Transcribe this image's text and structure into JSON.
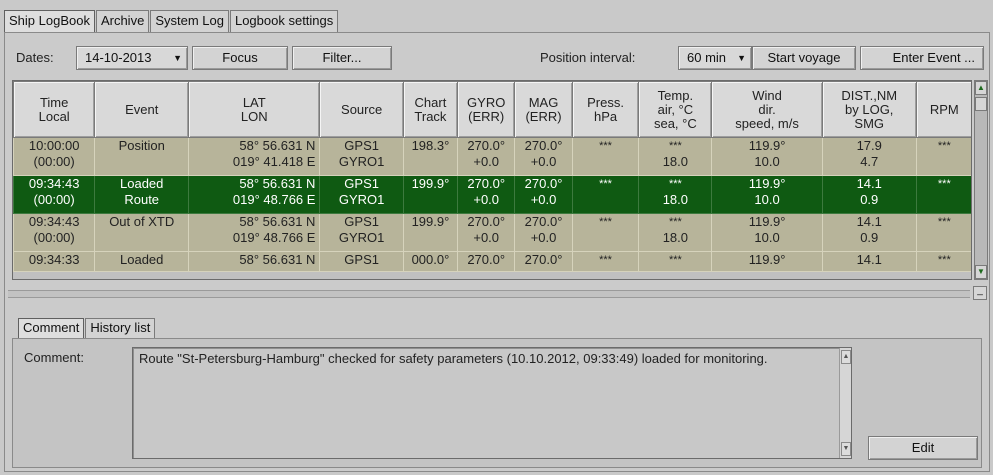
{
  "tabs": [
    "Ship LogBook",
    "Archive",
    "System Log",
    "Logbook settings"
  ],
  "toolbar": {
    "dates_label": "Dates:",
    "date_value": "14-10-2013",
    "focus": "Focus",
    "filter": "Filter...",
    "position_interval_label": "Position interval:",
    "interval_value": "60 min",
    "start_voyage": "Start voyage",
    "enter_event": "Enter Event ..."
  },
  "columns": [
    [
      "Time",
      "Local"
    ],
    [
      "Event"
    ],
    [
      "LAT",
      "LON"
    ],
    [
      "Source"
    ],
    [
      "Chart",
      "Track"
    ],
    [
      "GYRO",
      "(ERR)"
    ],
    [
      "MAG",
      "(ERR)"
    ],
    [
      "Press.",
      "hPa"
    ],
    [
      "Temp.",
      "air, °C",
      "sea, °C"
    ],
    [
      "Wind",
      "dir.",
      "speed, m/s"
    ],
    [
      "DIST.,NM",
      "by LOG,",
      "SMG"
    ],
    [
      "RPM"
    ]
  ],
  "rows": [
    {
      "selected": false,
      "time": [
        "10:00:00",
        "(00:00)"
      ],
      "event": [
        "Position",
        ""
      ],
      "latlon": [
        "58° 56.631 N",
        "019° 41.418 E"
      ],
      "source": [
        "GPS1",
        "GYRO1"
      ],
      "track": "198.3°",
      "gyro": [
        "270.0°",
        "+0.0"
      ],
      "mag": [
        "270.0°",
        "+0.0"
      ],
      "press": "***",
      "temp": [
        "***",
        "18.0"
      ],
      "wind": [
        "119.9°",
        "10.0"
      ],
      "dist": [
        "17.9",
        "4.7"
      ],
      "rpm": "***"
    },
    {
      "selected": true,
      "time": [
        "09:34:43",
        "(00:00)"
      ],
      "event": [
        "Loaded",
        "Route"
      ],
      "latlon": [
        "58° 56.631 N",
        "019° 48.766 E"
      ],
      "source": [
        "GPS1",
        "GYRO1"
      ],
      "track": "199.9°",
      "gyro": [
        "270.0°",
        "+0.0"
      ],
      "mag": [
        "270.0°",
        "+0.0"
      ],
      "press": "***",
      "temp": [
        "***",
        "18.0"
      ],
      "wind": [
        "119.9°",
        "10.0"
      ],
      "dist": [
        "14.1",
        "0.9"
      ],
      "rpm": "***"
    },
    {
      "selected": false,
      "time": [
        "09:34:43",
        "(00:00)"
      ],
      "event": [
        "Out of XTD",
        ""
      ],
      "latlon": [
        "58° 56.631 N",
        "019° 48.766 E"
      ],
      "source": [
        "GPS1",
        "GYRO1"
      ],
      "track": "199.9°",
      "gyro": [
        "270.0°",
        "+0.0"
      ],
      "mag": [
        "270.0°",
        "+0.0"
      ],
      "press": "***",
      "temp": [
        "***",
        "18.0"
      ],
      "wind": [
        "119.9°",
        "10.0"
      ],
      "dist": [
        "14.1",
        "0.9"
      ],
      "rpm": "***"
    },
    {
      "selected": false,
      "partial": true,
      "time": [
        "09:34:33"
      ],
      "event": [
        "Loaded"
      ],
      "latlon": [
        "58° 56.631 N"
      ],
      "source": [
        "GPS1"
      ],
      "track": "000.0°",
      "gyro": [
        "270.0°"
      ],
      "mag": [
        "270.0°"
      ],
      "press": "***",
      "temp": [
        "***"
      ],
      "wind": [
        "119.9°"
      ],
      "dist": [
        "14.1"
      ],
      "rpm": "***"
    }
  ],
  "sub_tabs": [
    "Comment",
    "History list"
  ],
  "comment": {
    "label": "Comment:",
    "text": "Route \"St-Petersburg-Hamburg\" checked for safety parameters (10.10.2012, 09:33:49) loaded for monitoring.",
    "edit": "Edit"
  },
  "colors": {
    "row_bg": "#b7b49a",
    "selected_row_bg": "#0f5a12",
    "panel_bg": "#c9c9c9"
  }
}
